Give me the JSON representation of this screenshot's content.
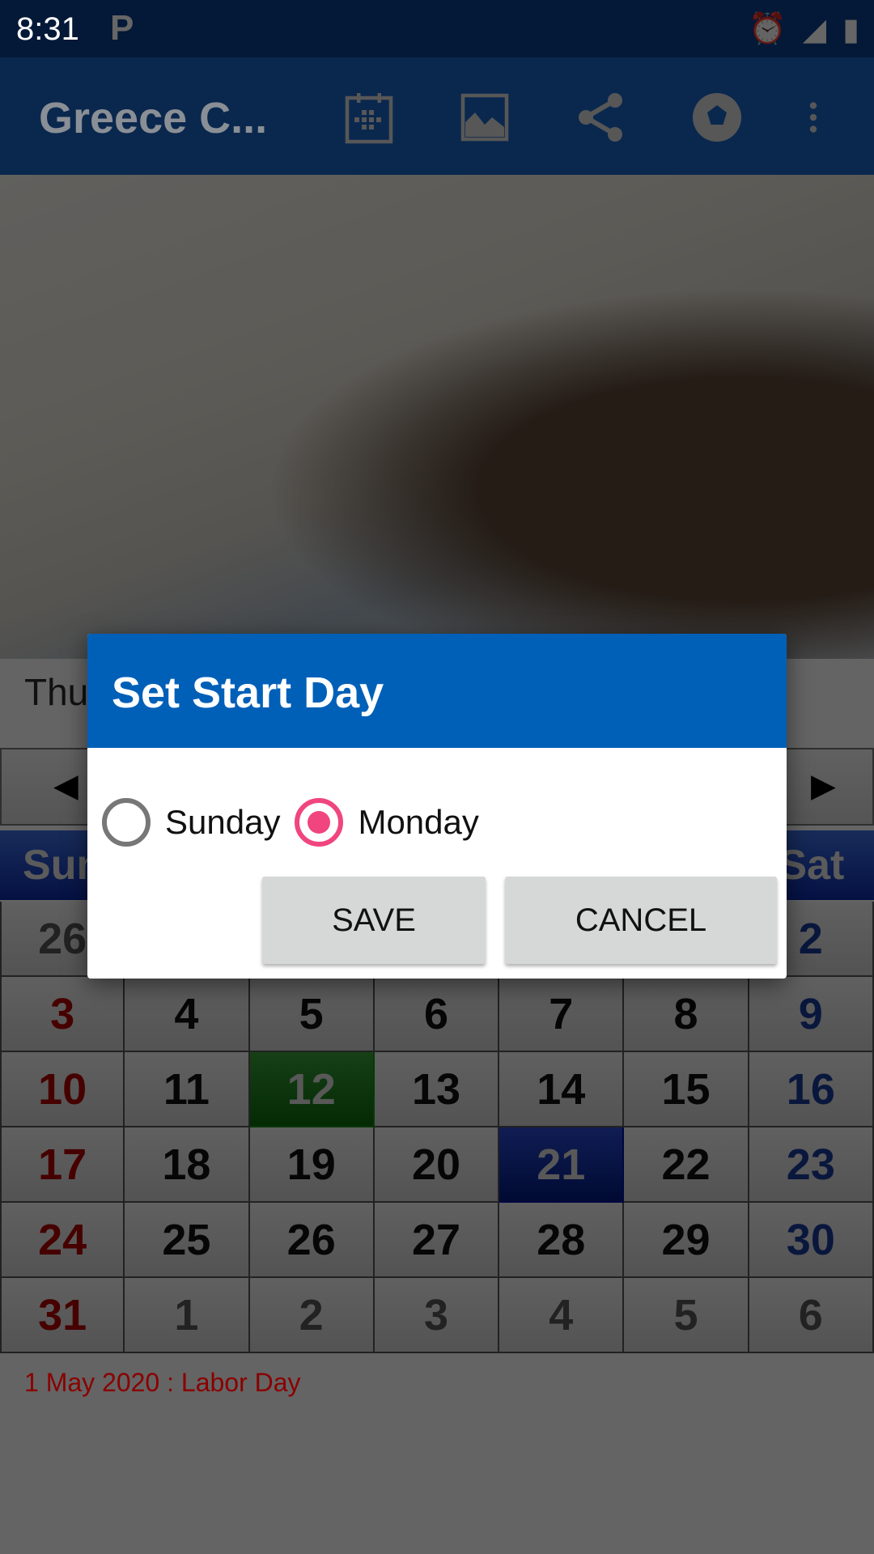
{
  "status_bar": {
    "time": "8:31",
    "notification_icon": "p-icon",
    "icons": [
      "alarm-icon",
      "signal-no-data-icon",
      "battery-charging-icon"
    ]
  },
  "app_bar": {
    "title": "Greece C...",
    "actions": [
      "calendar-icon",
      "image-icon",
      "share-icon",
      "soccer-ball-icon",
      "more-vert-icon"
    ]
  },
  "today_text": "Thu",
  "calendar": {
    "prev": "◀",
    "next": "▶",
    "headers": [
      "Sun",
      "",
      "",
      "",
      "",
      "",
      "Sat"
    ],
    "rows": [
      [
        "26",
        "",
        "",
        "",
        "",
        "",
        "2"
      ],
      [
        "3",
        "4",
        "5",
        "6",
        "7",
        "8",
        "9"
      ],
      [
        "10",
        "11",
        "12",
        "13",
        "14",
        "15",
        "16"
      ],
      [
        "17",
        "18",
        "19",
        "20",
        "21",
        "22",
        "23"
      ],
      [
        "24",
        "25",
        "26",
        "27",
        "28",
        "29",
        "30"
      ],
      [
        "31",
        "1",
        "2",
        "3",
        "4",
        "5",
        "6"
      ]
    ],
    "highlighted_day": "12",
    "selected_day": "21",
    "colors": {
      "sunday": "#b00000",
      "saturday": "#1a3a9a",
      "highlight": "#1a8a1a",
      "selected": "#0010a0",
      "header": "#0c2aa8"
    }
  },
  "holiday_note": "1 May 2020 : Labor Day",
  "dialog": {
    "title": "Set Start Day",
    "options": [
      {
        "label": "Sunday",
        "checked": false
      },
      {
        "label": "Monday",
        "checked": true
      }
    ],
    "save_label": "SAVE",
    "cancel_label": "CANCEL",
    "accent": "#f0457e",
    "title_bg": "#0060b8"
  }
}
